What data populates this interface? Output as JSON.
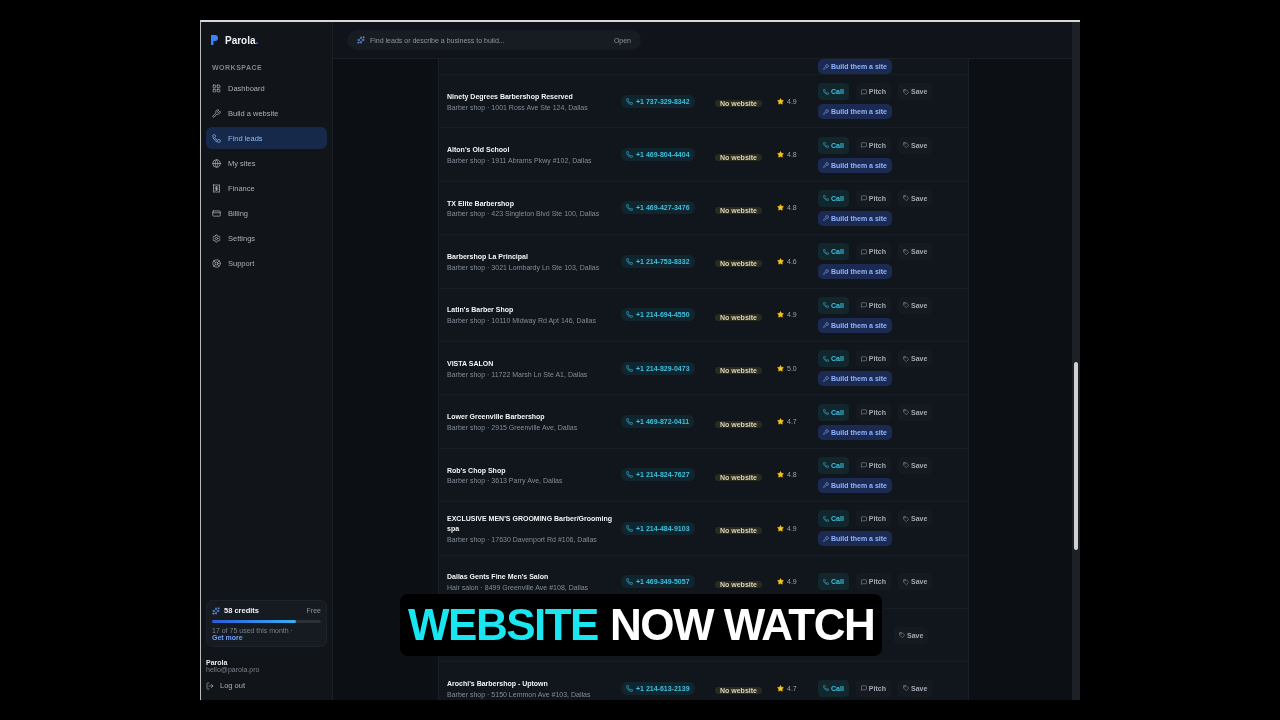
{
  "sidebar": {
    "brand": "Parola",
    "brand_dot": ".",
    "section": "WORKSPACE",
    "items": [
      {
        "label": "Dashboard",
        "selected": false
      },
      {
        "label": "Build a website",
        "selected": false
      },
      {
        "label": "Find leads",
        "selected": true
      },
      {
        "label": "My sites",
        "selected": false
      },
      {
        "label": "Finance",
        "selected": false
      },
      {
        "label": "Billing",
        "selected": false
      },
      {
        "label": "Settings",
        "selected": false
      },
      {
        "label": "Support",
        "selected": false
      }
    ],
    "credits": {
      "title": "58 credits",
      "plan": "Free",
      "level": 0.77,
      "note": "17 of 75 used this month ·",
      "link": "Get more"
    },
    "user": {
      "name": "Parola",
      "email": "hello@parola.pro",
      "logout": "Log out"
    }
  },
  "search": {
    "placeholder": "Find leads or describe a business to build...",
    "shortcut": "Open"
  },
  "leads": [
    {
      "build": "Build them a site"
    },
    {
      "name": "Ninety Degrees Barbershop Reserved",
      "address": "Barber shop · 1001 Ross Ave Ste 124, Dallas",
      "phone": "+1 737-329-8342",
      "badge": "No website",
      "rating": "4.9",
      "call": "Call",
      "pitch": "Pitch",
      "save": "Save",
      "build": "Build them a site"
    },
    {
      "name": "Alton's Old School",
      "address": "Barber shop · 1911 Abrams Pkwy #102, Dallas",
      "phone": "+1 469-804-4404",
      "badge": "No website",
      "rating": "4.8",
      "call": "Call",
      "pitch": "Pitch",
      "save": "Save",
      "build": "Build them a site"
    },
    {
      "name": "TX Elite Barbershop",
      "address": "Barber shop · 423 Singleton Blvd Ste 100, Dallas",
      "phone": "+1 469-427-3476",
      "badge": "No website",
      "rating": "4.8",
      "call": "Call",
      "pitch": "Pitch",
      "save": "Save",
      "build": "Build them a site"
    },
    {
      "name": "Barbershop La Principal",
      "address": "Barber shop · 3021 Lombardy Ln Ste 103, Dallas",
      "phone": "+1 214-753-8332",
      "badge": "No website",
      "rating": "4.6",
      "call": "Call",
      "pitch": "Pitch",
      "save": "Save",
      "build": "Build them a site"
    },
    {
      "name": "Latin's Barber Shop",
      "address": "Barber shop · 10110 Midway Rd Apt 146, Dallas",
      "phone": "+1 214-694-4550",
      "badge": "No website",
      "rating": "4.9",
      "call": "Call",
      "pitch": "Pitch",
      "save": "Save",
      "build": "Build them a site"
    },
    {
      "name": "VISTA SALON",
      "address": "Barber shop · 11722 Marsh Ln Ste A1, Dallas",
      "phone": "+1 214-829-0473",
      "badge": "No website",
      "rating": "5.0",
      "call": "Call",
      "pitch": "Pitch",
      "save": "Save",
      "build": "Build them a site"
    },
    {
      "name": "Lower Greenville Barbershop",
      "address": "Barber shop · 2915 Greenville Ave, Dallas",
      "phone": "+1 469-872-0411",
      "badge": "No website",
      "rating": "4.7",
      "call": "Call",
      "pitch": "Pitch",
      "save": "Save",
      "build": "Build them a site"
    },
    {
      "name": "Rob's Chop Shop",
      "address": "Barber shop · 3613 Parry Ave, Dallas",
      "phone": "+1 214-824-7627",
      "badge": "No website",
      "rating": "4.8",
      "call": "Call",
      "pitch": "Pitch",
      "save": "Save",
      "build": "Build them a site"
    },
    {
      "name": "EXCLUSIVE MEN'S GROOMING Barber/Grooming spa",
      "address": "Barber shop · 17630 Davenport Rd #106, Dallas",
      "phone": "+1 214-484-9103",
      "badge": "No website",
      "rating": "4.9",
      "call": "Call",
      "pitch": "Pitch",
      "save": "Save",
      "build": "Build them a site"
    },
    {
      "name": "Dallas Gents Fine Men's Salon",
      "address": "Hair salon · 8499 Greenville Ave #108, Dallas",
      "phone": "+1 469-349-5057",
      "badge": "No website",
      "rating": "4.9",
      "call": "Call",
      "pitch": "Pitch",
      "save": "Save"
    },
    {
      "save": "Save"
    },
    {
      "name": "Arochi's Barbershop - Uptown",
      "address": "Barber shop · 5150 Lemmon Ave #103, Dallas",
      "phone": "+1 214-613-2139",
      "badge": "No website",
      "rating": "4.7",
      "call": "Call",
      "pitch": "Pitch",
      "save": "Save"
    }
  ],
  "caption": {
    "parts": [
      {
        "text": "WEBSITE",
        "color": "#19e6f0"
      },
      {
        "text": "NOW WATCH",
        "color": "#ffffff"
      }
    ]
  }
}
